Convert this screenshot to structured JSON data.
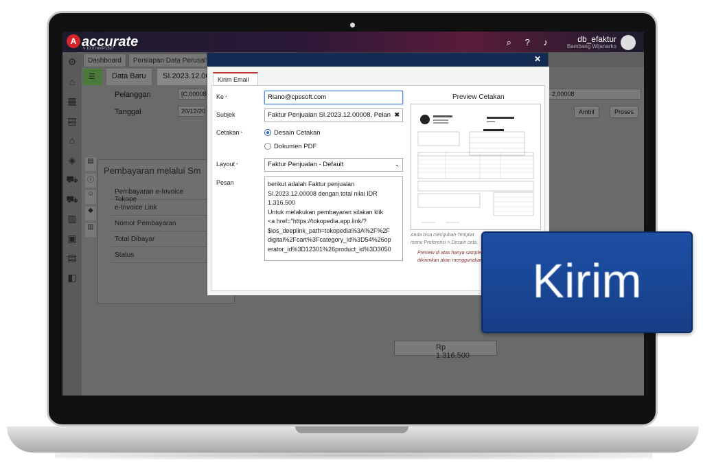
{
  "app": {
    "logo_text": "accurate",
    "logo_sub": "online",
    "version": "v 10.0 rev/P1327",
    "db_name": "db_efaktur",
    "user_name": "Bambang Wijanarko"
  },
  "tabs": [
    "Dashboard",
    "Persiapan Data Perusahaan"
  ],
  "subtabs": {
    "new_label": "Data Baru",
    "doc_label": "SI.2023.12.00008"
  },
  "form": {
    "customer_label": "Pelanggan",
    "customer_value": "[C.00008]",
    "date_label": "Tanggal",
    "date_value": "20/12/20",
    "right_field_value": "2.00008",
    "ambil_label": "Ambil",
    "proses_label": "Proses",
    "amount_value": "Rp 1.316.500"
  },
  "payment_panel": {
    "title": "Pembayaran melalui Sm",
    "rows": [
      "Pembayaran e-Invoice Tokope",
      "e-Invoice Link",
      "Nomor Pembayaran",
      "Total Dibayar",
      "Status"
    ]
  },
  "modal": {
    "tab_label": "Kirim Email",
    "to_label": "Ke",
    "to_value": "Riano@cpssoft.com",
    "subject_label": "Subjek",
    "subject_value": "Faktur Penjualan SI.2023.12.00008, Pelan",
    "print_label": "Cetakan",
    "print_options": [
      "Desain Cetakan",
      "Dokumen PDF"
    ],
    "print_selected": "Desain Cetakan",
    "layout_label": "Layout",
    "layout_value": "Faktur Penjualan - Default",
    "message_label": "Pesan",
    "message_lines": [
      "berikut adalah Faktur penjualan",
      "SI.2023.12.00008 dengan total nilai IDR",
      "1.316.500",
      "Untuk melakukan pembayaran silakan klik",
      "<a href=\"https://tokopedia.app.link/?",
      "$ios_deeplink_path=tokopedia%3A%2F%2F",
      "digital%2Fcart%3Fcategory_id%3D54%26op",
      "erator_id%3D12301%26product_id%3D3050"
    ],
    "preview_title": "Preview Cetakan",
    "preview_doc_title": "Faktur Penjualan",
    "preview_company": "Rocketing Allrounder",
    "preview_note": "Anda bisa mengubah Templat menu Preferensi > Desain ceta",
    "preview_note2": "Preview di atas hanya sample dikirimkan akan menggunakan"
  },
  "send_button": {
    "label": "Kirim",
    "color": "#1d4fa6"
  }
}
